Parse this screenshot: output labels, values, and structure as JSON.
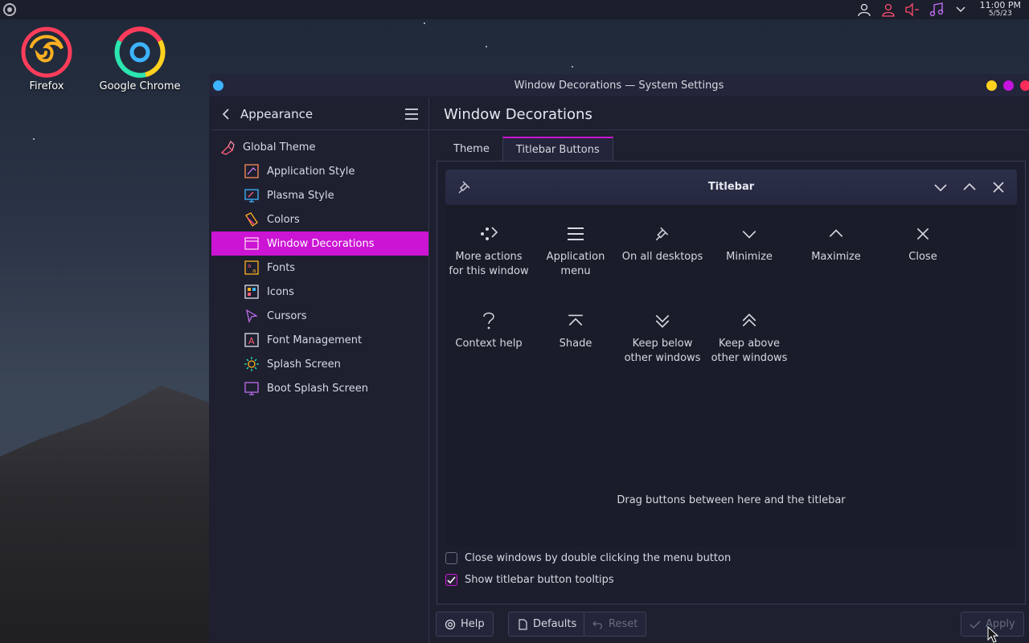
{
  "panel": {
    "clock_time": "11:00 PM",
    "clock_date": "5/5/23"
  },
  "desktop": {
    "icons": [
      {
        "label": "Firefox",
        "icon": "firefox-icon"
      },
      {
        "label": "Google Chrome",
        "icon": "chrome-icon"
      }
    ]
  },
  "window": {
    "title": "Window Decorations — System Settings"
  },
  "sidebar": {
    "header": "Appearance",
    "items": [
      {
        "label": "Global Theme",
        "icon": "brush-icon"
      },
      {
        "label": "Application Style",
        "icon": "app-style-icon"
      },
      {
        "label": "Plasma Style",
        "icon": "plasma-style-icon"
      },
      {
        "label": "Colors",
        "icon": "colors-icon"
      },
      {
        "label": "Window Decorations",
        "icon": "window-decorations-icon"
      },
      {
        "label": "Fonts",
        "icon": "fonts-icon"
      },
      {
        "label": "Icons",
        "icon": "icons-icon"
      },
      {
        "label": "Cursors",
        "icon": "cursor-icon"
      },
      {
        "label": "Font Management",
        "icon": "font-management-icon"
      },
      {
        "label": "Splash Screen",
        "icon": "splash-screen-icon"
      },
      {
        "label": "Boot Splash Screen",
        "icon": "boot-splash-icon"
      }
    ]
  },
  "main": {
    "title": "Window Decorations",
    "tabs": [
      {
        "label": "Theme"
      },
      {
        "label": "Titlebar Buttons"
      }
    ],
    "preview_title": "Titlebar",
    "buttons": [
      {
        "line1": "More actions",
        "line2": "for this window",
        "icon": "more-actions-icon"
      },
      {
        "line1": "Application",
        "line2": "menu",
        "icon": "hamburger-icon"
      },
      {
        "line1": "On all desktops",
        "line2": "",
        "icon": "pin-icon"
      },
      {
        "line1": "Minimize",
        "line2": "",
        "icon": "chevron-down-icon"
      },
      {
        "line1": "Maximize",
        "line2": "",
        "icon": "chevron-up-icon"
      },
      {
        "line1": "Close",
        "line2": "",
        "icon": "close-icon"
      },
      {
        "line1": "Context help",
        "line2": "",
        "icon": "help-icon"
      },
      {
        "line1": "Shade",
        "line2": "",
        "icon": "shade-icon"
      },
      {
        "line1": "Keep below",
        "line2": "other windows",
        "icon": "keep-below-icon"
      },
      {
        "line1": "Keep above",
        "line2": "other windows",
        "icon": "keep-above-icon"
      }
    ],
    "drag_hint": "Drag buttons between here and the titlebar",
    "check_close_dblclick": "Close windows by double clicking the menu button",
    "check_close_dblclick_checked": false,
    "check_tooltips": "Show titlebar button tooltips",
    "check_tooltips_checked": true
  },
  "footer": {
    "help": "Help",
    "defaults": "Defaults",
    "reset": "Reset",
    "apply": "Apply"
  },
  "colors": {
    "accent": "#cb14d4",
    "background": "#1e2030"
  }
}
